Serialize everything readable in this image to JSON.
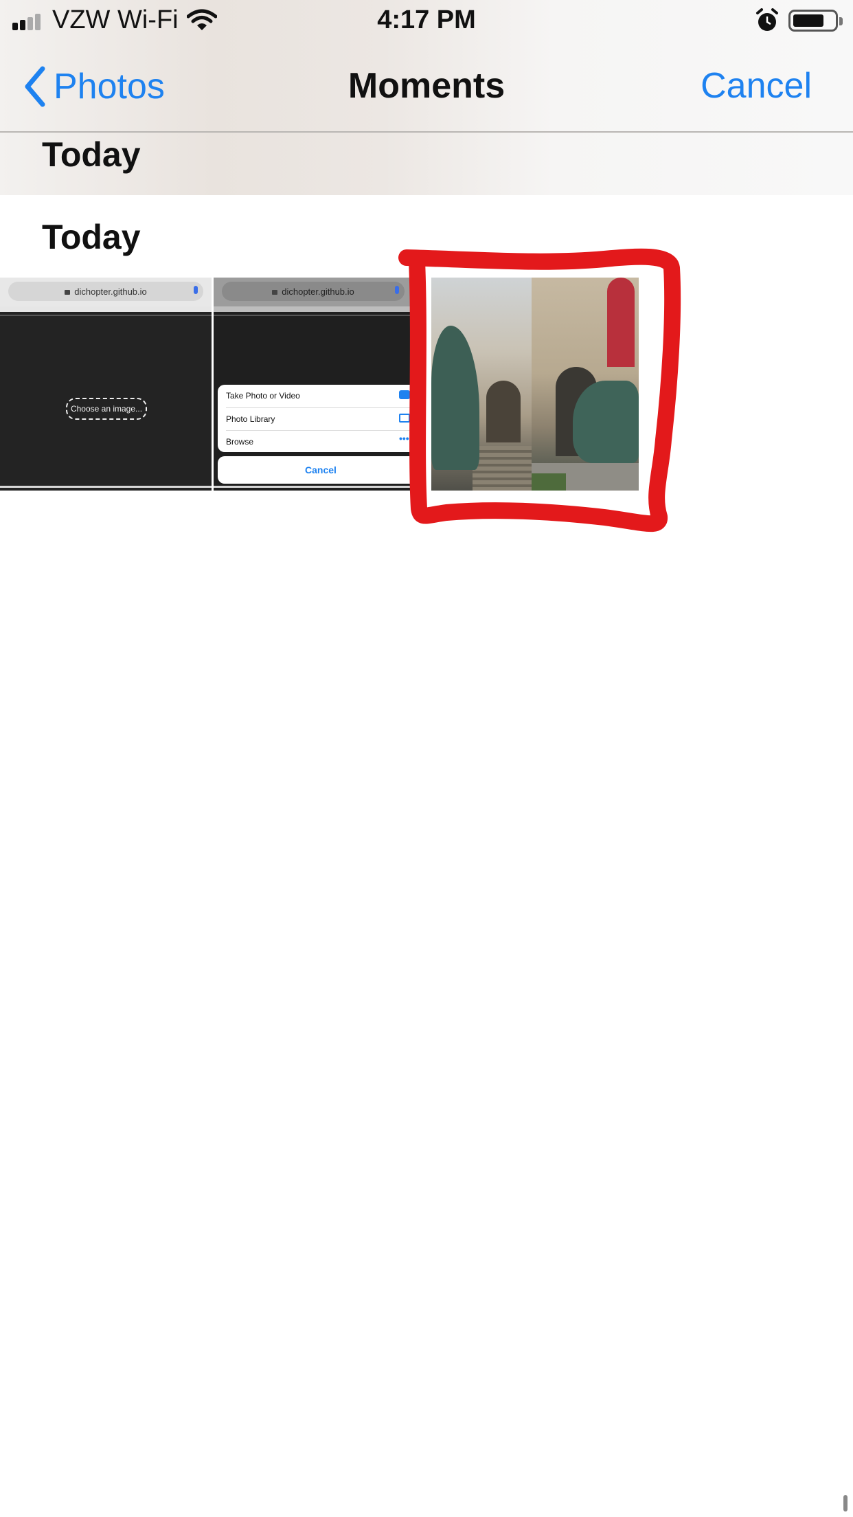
{
  "status_bar": {
    "carrier": "VZW Wi-Fi",
    "time": "4:17 PM"
  },
  "nav": {
    "back_label": "Photos",
    "title": "Moments",
    "cancel_label": "Cancel"
  },
  "sticky_header": "Today",
  "section_header": "Today",
  "thumbnails": [
    {
      "url": "dichopter.github.io",
      "button_text": "Choose an image..."
    },
    {
      "url": "dichopter.github.io",
      "sheet_options": [
        "Take Photo or Video",
        "Photo Library",
        "Browse"
      ],
      "sheet_cancel": "Cancel"
    }
  ],
  "colors": {
    "accent": "#1e82f0",
    "annotation": "#e3191b"
  },
  "icons": [
    "signal-icon",
    "wifi-icon",
    "alarm-icon",
    "battery-icon",
    "chevron-left-icon",
    "lock-icon",
    "mic-icon",
    "camera-icon",
    "photo-library-icon",
    "more-icon"
  ]
}
